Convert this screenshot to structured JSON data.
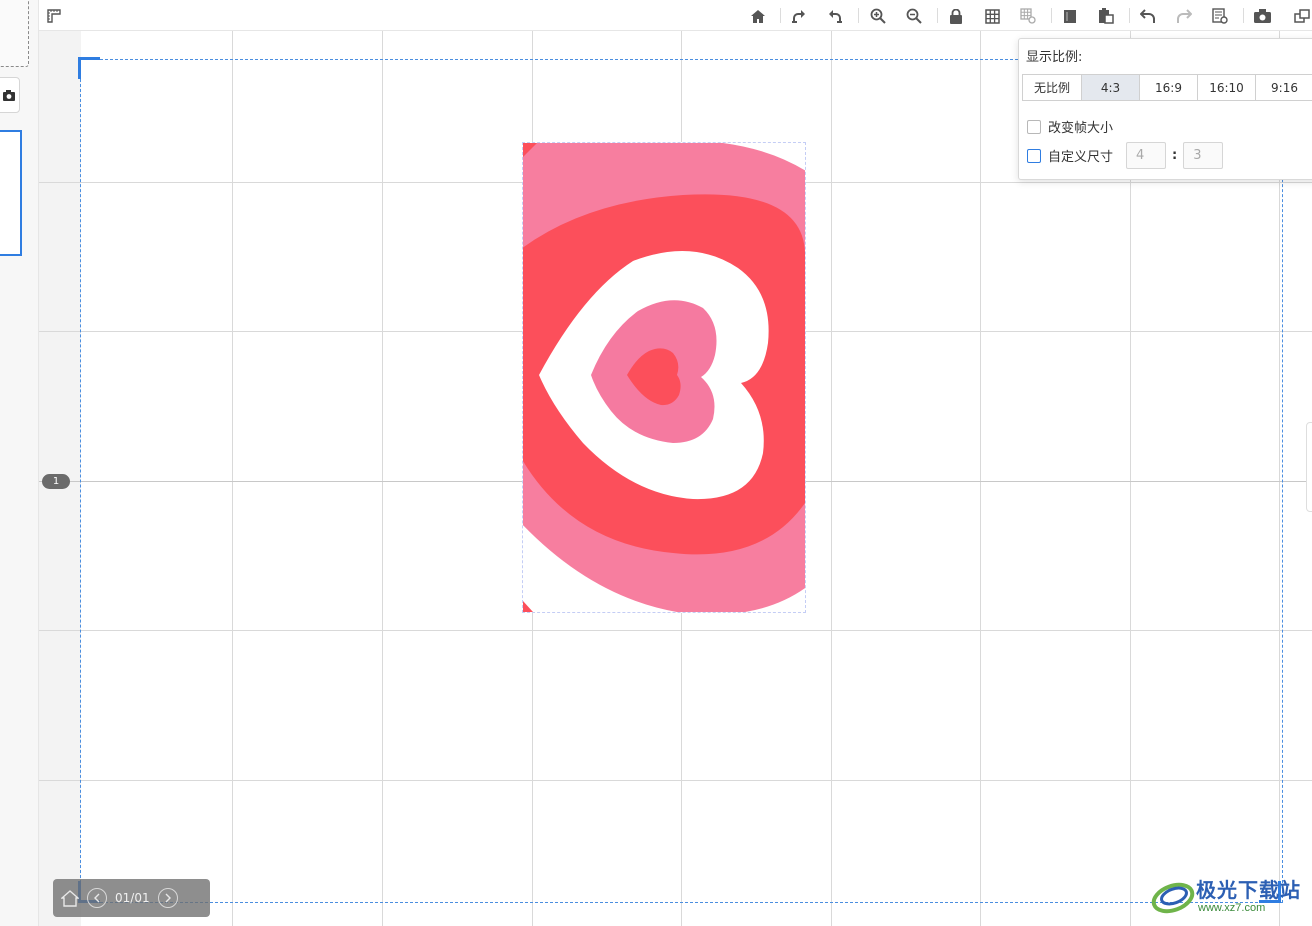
{
  "toolbar": {
    "icons": [
      "ruler-icon",
      "home-icon",
      "rotate-right-icon",
      "rotate-left-icon",
      "zoom-in-icon",
      "zoom-out-icon",
      "lock-icon",
      "grid-icon",
      "grid-settings-icon",
      "copy-icon",
      "paste-icon",
      "undo-icon",
      "redo-icon",
      "properties-icon",
      "camera-icon",
      "window-icon"
    ]
  },
  "canvas": {
    "pin_label": "1"
  },
  "pager": {
    "page_text": "01/01"
  },
  "ratio_popup": {
    "title": "显示比例:",
    "ratios": [
      "无比例",
      "4:3",
      "16:9",
      "16:10",
      "9:16"
    ],
    "selected": "4:3",
    "change_frame_size_label": "改变帧大小",
    "custom_size_label": "自定义尺寸",
    "custom_width": "4",
    "custom_height": "3",
    "colon": ":"
  },
  "watermark": {
    "name": "极光下载站",
    "url": "www.xz7.com"
  },
  "colors": {
    "accent": "#2f7de1",
    "heart_red": "#fc4f5b",
    "heart_pink": "#f77e9f"
  }
}
